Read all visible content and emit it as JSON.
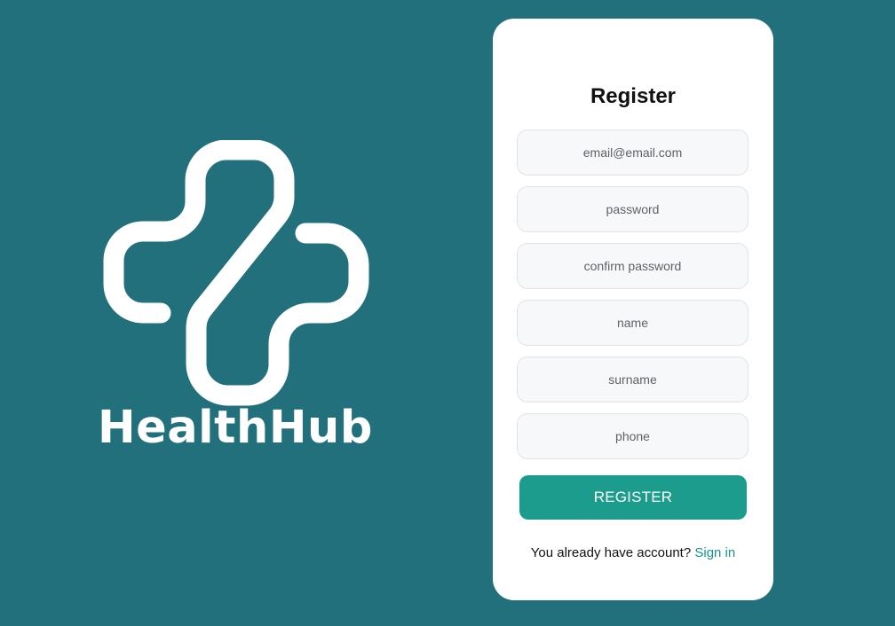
{
  "brand": {
    "name": "HealthHub",
    "logo_icon": "medical-cross-icon"
  },
  "register_form": {
    "title": "Register",
    "fields": {
      "email": {
        "placeholder": "email@email.com",
        "value": ""
      },
      "password": {
        "placeholder": "password",
        "value": ""
      },
      "confirm_password": {
        "placeholder": "confirm password",
        "value": ""
      },
      "name": {
        "placeholder": "name",
        "value": ""
      },
      "surname": {
        "placeholder": "surname",
        "value": ""
      },
      "phone": {
        "placeholder": "phone",
        "value": ""
      }
    },
    "submit_label": "REGISTER",
    "signin_prompt": "You already have account?",
    "signin_link_label": "Sign in"
  },
  "colors": {
    "page_background": "#22707b",
    "card_background": "#ffffff",
    "primary_button": "#1b9c8c",
    "link": "#16938b"
  }
}
